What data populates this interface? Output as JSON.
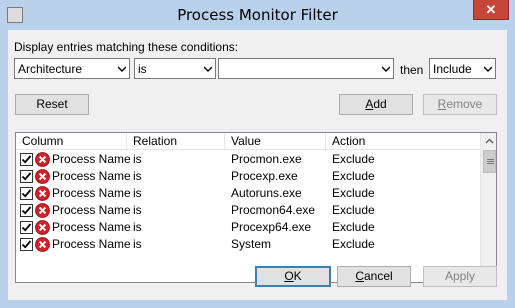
{
  "window": {
    "title": "Process Monitor Filter",
    "close_glyph": "✕"
  },
  "filter": {
    "prompt": "Display entries matching these conditions:",
    "column_value": "Architecture",
    "relation_value": "is",
    "value_value": "",
    "then_label": "then",
    "action_value": "Include"
  },
  "buttons": {
    "reset": "Reset",
    "add_prefix": "",
    "add_mnemonic": "A",
    "add_rest": "dd",
    "remove_prefix": "",
    "remove_mnemonic": "R",
    "remove_rest": "emove",
    "ok_prefix": "",
    "ok_mnemonic": "O",
    "ok_rest": "K",
    "cancel_prefix": "",
    "cancel_mnemonic": "C",
    "cancel_rest": "ancel",
    "apply": "Apply"
  },
  "table": {
    "headers": [
      "Column",
      "Relation",
      "Value",
      "Action"
    ],
    "rows": [
      {
        "column": "Process Name",
        "relation": "is",
        "value": "Procmon.exe",
        "action": "Exclude",
        "checked": true
      },
      {
        "column": "Process Name",
        "relation": "is",
        "value": "Procexp.exe",
        "action": "Exclude",
        "checked": true
      },
      {
        "column": "Process Name",
        "relation": "is",
        "value": "Autoruns.exe",
        "action": "Exclude",
        "checked": true
      },
      {
        "column": "Process Name",
        "relation": "is",
        "value": "Procmon64.exe",
        "action": "Exclude",
        "checked": true
      },
      {
        "column": "Process Name",
        "relation": "is",
        "value": "Procexp64.exe",
        "action": "Exclude",
        "checked": true
      },
      {
        "column": "Process Name",
        "relation": "is",
        "value": "System",
        "action": "Exclude",
        "checked": true
      }
    ]
  },
  "colors": {
    "frame": "#b9d1ea",
    "close": "#c7463c",
    "exclude_icon": "#d32027",
    "default_button_border": "#3c7fb1"
  },
  "icons": {
    "system_menu": "window-icon",
    "exclude": "red-x-circle-icon",
    "checkbox": "checkmark-icon",
    "dropdown": "chevron-down-icon"
  }
}
